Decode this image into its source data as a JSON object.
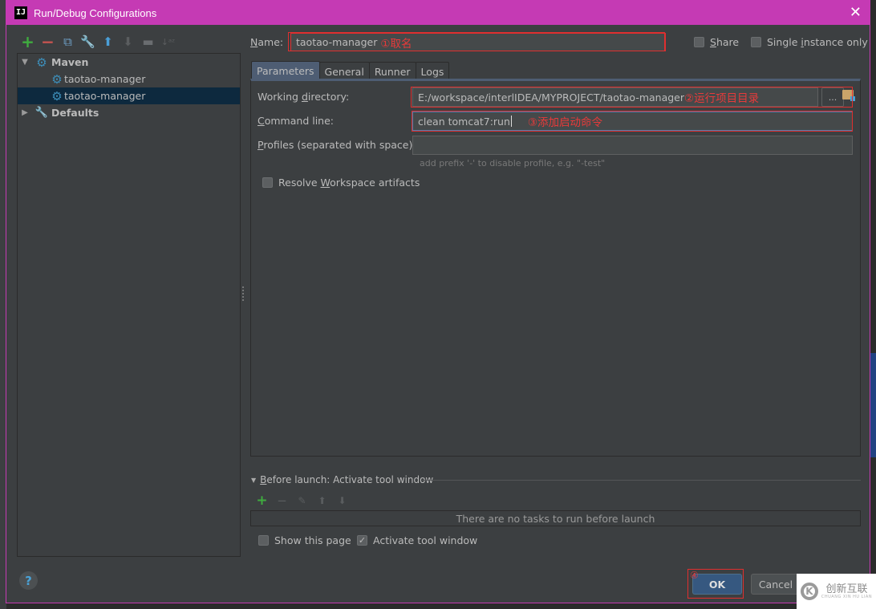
{
  "window": {
    "app_icon": "IJ",
    "title": "Run/Debug Configurations",
    "close_icon": "✕"
  },
  "left_toolbar": [
    {
      "name": "add-config-button",
      "icon": "+",
      "cls": "add"
    },
    {
      "name": "remove-config-button",
      "icon": "−",
      "cls": "remove"
    },
    {
      "name": "copy-config-button",
      "icon": "⧉",
      "cls": "copy"
    },
    {
      "name": "edit-defaults-button",
      "icon": "🔧",
      "cls": "wrench"
    },
    {
      "name": "move-up-button",
      "icon": "⬆",
      "cls": "up"
    },
    {
      "name": "move-down-button",
      "icon": "⬇",
      "cls": "down"
    },
    {
      "name": "new-folder-button",
      "icon": "▬",
      "cls": "folder"
    },
    {
      "name": "sort-button",
      "icon": "↓ᵃᶻ",
      "cls": "sort"
    }
  ],
  "tree": {
    "maven": {
      "label": "Maven",
      "expanded": true
    },
    "items": [
      {
        "label": "taotao-manager",
        "selected": false
      },
      {
        "label": "taotao-manager",
        "selected": true
      }
    ],
    "defaults": {
      "label": "Defaults",
      "expanded": false
    }
  },
  "name_field": {
    "label_u": "N",
    "label_rest": "ame:",
    "value": "taotao-manager",
    "annotation": "①取名"
  },
  "share": {
    "label_u": "S",
    "label_rest": "hare",
    "checked": false
  },
  "single_instance": {
    "label_pre": "Single ",
    "label_u": "i",
    "label_rest": "nstance only",
    "checked": false
  },
  "tabs": [
    {
      "label": "Parameters",
      "active": true
    },
    {
      "label": "General",
      "active": false
    },
    {
      "label": "Runner",
      "active": false
    },
    {
      "label": "Logs",
      "active": false
    }
  ],
  "parameters": {
    "working_dir": {
      "label_pre": "Working ",
      "label_u": "d",
      "label_rest": "irectory:",
      "value": "E:/workspace/interlIDEA/MYPROJECT/taotao-manager",
      "annotation": "②运行项目目录",
      "browse_label": "..."
    },
    "command_line": {
      "label_u": "C",
      "label_rest": "ommand line:",
      "value": "clean tomcat7:run",
      "annotation": "③添加启动命令"
    },
    "profiles": {
      "label_u": "P",
      "label_rest": "rofiles (separated with space):",
      "value": "",
      "hint": "add prefix '-' to disable profile, e.g. \"-test\""
    },
    "resolve_workspace": {
      "label_pre": "Resolve ",
      "label_u": "W",
      "label_rest": "orkspace artifacts",
      "checked": false
    }
  },
  "before_launch": {
    "label_u": "B",
    "label_rest": "efore launch: Activate tool window",
    "empty_text": "There are no tasks to run before launch",
    "show_this_page": {
      "label": "Show this page",
      "checked": false
    },
    "activate_tool_window": {
      "label": "Activate tool window",
      "checked": true
    }
  },
  "buttons": {
    "help": "?",
    "ok": "OK",
    "ok_annotation": "④",
    "cancel": "Cancel"
  },
  "watermark": {
    "logo": "K",
    "text": "创新互联",
    "sub": "CHUANG XIN HU LIAN"
  }
}
